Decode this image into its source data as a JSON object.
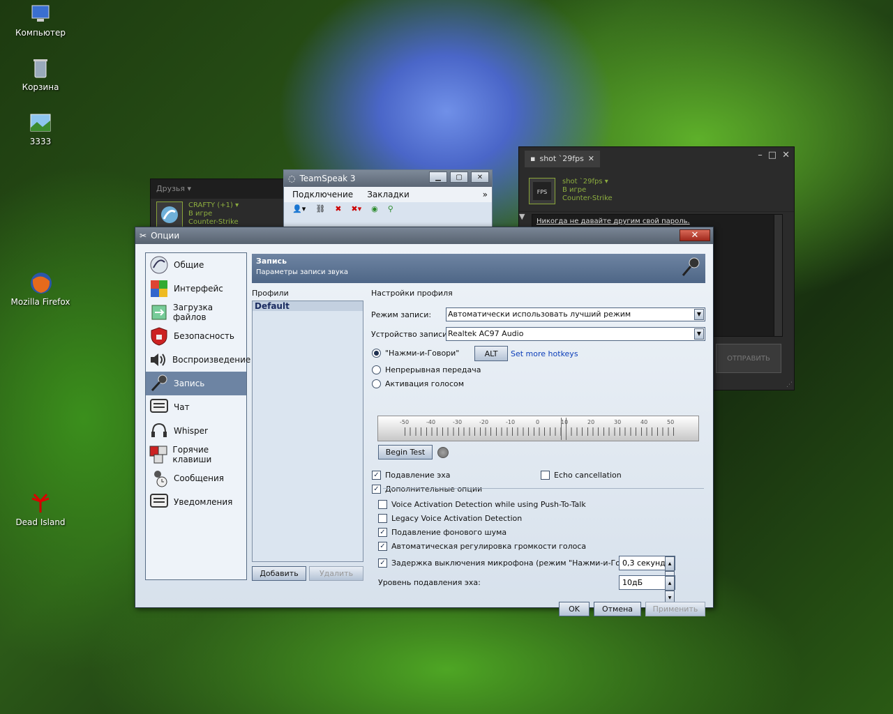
{
  "desktop": {
    "icons": [
      {
        "label": "Компьютер",
        "icon": "computer-icon"
      },
      {
        "label": "Корзина",
        "icon": "recycle-bin-icon"
      },
      {
        "label": "3333",
        "icon": "image-file-icon"
      },
      {
        "label": "Mozilla Firefox",
        "icon": "firefox-icon"
      },
      {
        "label": "Dead Island",
        "icon": "dead-island-icon"
      }
    ]
  },
  "friends_window": {
    "header": "Друзья",
    "friend": {
      "name": "CRAFTY (+1)",
      "status": "В игре",
      "game": "Counter-Strike"
    }
  },
  "chat_window": {
    "tab": "shot `29fps",
    "user": {
      "name": "shot `29fps",
      "status": "В игре",
      "game": "Counter-Strike"
    },
    "warning": "Никогда не давайте другим свой пароль.",
    "send_label": "ОТПРАВИТЬ"
  },
  "teamspeak": {
    "title": "TeamSpeak 3",
    "menu": [
      "Подключение",
      "Закладки"
    ],
    "more": "»"
  },
  "options": {
    "title": "Опции",
    "nav": [
      {
        "label": "Общие",
        "icon": "teamspeak-general-icon"
      },
      {
        "label": "Интерфейс",
        "icon": "interface-icon"
      },
      {
        "label": "Загрузка файлов",
        "icon": "file-transfer-icon"
      },
      {
        "label": "Безопасность",
        "icon": "security-lock-icon"
      },
      {
        "label": "Воспроизведение",
        "icon": "speaker-icon"
      },
      {
        "label": "Запись",
        "icon": "microphone-icon"
      },
      {
        "label": "Чат",
        "icon": "chat-icon"
      },
      {
        "label": "Whisper",
        "icon": "whisper-headset-icon"
      },
      {
        "label": "Горячие клавиши",
        "icon": "hotkeys-icon"
      },
      {
        "label": "Сообщения",
        "icon": "messages-icon"
      },
      {
        "label": "Уведомления",
        "icon": "notifications-icon"
      }
    ],
    "selected_nav": "Запись",
    "header_title": "Запись",
    "header_subtitle": "Параметры записи звука",
    "profiles_label": "Профили",
    "profile_settings_label": "Настройки профиля",
    "profiles": [
      "Default"
    ],
    "add_button": "Добавить",
    "delete_button": "Удалить",
    "capture_mode_label": "Режим записи:",
    "capture_mode_value": "Автоматически использовать лучший режим",
    "capture_device_label": "Устройство записи:",
    "capture_device_value": "Realtek AC97 Audio",
    "ptt_label": "\"Нажми-и-Говори\"",
    "ptt_hotkey": "ALT",
    "set_more_hotkeys": "Set more hotkeys",
    "continuous_label": "Непрерывная передача",
    "voice_activation_label": "Активация голосом",
    "meter_ticks": [
      "-50",
      "-40",
      "-30",
      "-20",
      "-10",
      "0",
      "10",
      "20",
      "30",
      "40",
      "50"
    ],
    "begin_test": "Begin Test",
    "echo_suppression": "Подавление эха",
    "echo_cancellation": "Echo cancellation",
    "advanced_options": "Дополнительные опции",
    "vad_ptt": "Voice Activation Detection while using Push-To-Talk",
    "legacy_vad": "Legacy Voice Activation Detection",
    "noise_suppression": "Подавление фонового шума",
    "agc": "Автоматическая регулировка громкости голоса",
    "mic_delay_label": "Задержка выключения микрофона (режим \"Нажми-и-Говори\"):",
    "mic_delay_value": "0,3 секунд",
    "echo_level_label": "Уровень подавления эха:",
    "echo_level_value": "10дБ",
    "ok": "OK",
    "cancel": "Отмена",
    "apply": "Применить"
  }
}
